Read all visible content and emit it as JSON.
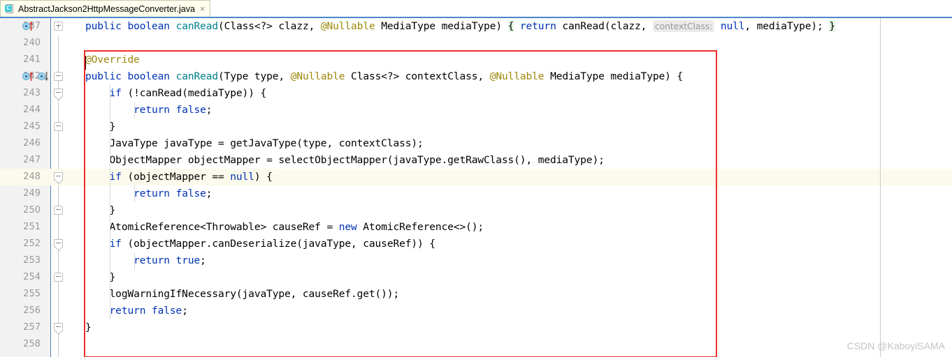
{
  "tab": {
    "icon": "java-class-icon",
    "icon_letter": "C",
    "label": "AbstractJackson2HttpMessageConverter.java",
    "close_glyph": "×"
  },
  "editor": {
    "language": "java",
    "current_line": 248,
    "right_margin_column_guide": true,
    "colors": {
      "keyword": "#0033b3",
      "method": "#00808c",
      "annotation": "#9e880d",
      "text": "#000000",
      "line_number": "#999999",
      "gutter_bg": "#f2f2f2",
      "current_line_bg": "#fcfaec",
      "brace_match_bg": "#e3f7e3",
      "param_hint_bg": "#ebebeb",
      "param_hint_fg": "#999999",
      "annotation_box": "#ee2f2a"
    },
    "lines": [
      {
        "number": "237",
        "gutter_icons": [
          "implementing-method-icon"
        ],
        "fold": "plus",
        "indent_guides": 0,
        "tokens": [
          {
            "t": "public",
            "c": "kw"
          },
          {
            "t": " ",
            "c": "pun"
          },
          {
            "t": "boolean",
            "c": "kw"
          },
          {
            "t": " ",
            "c": "pun"
          },
          {
            "t": "canRead",
            "c": "mth"
          },
          {
            "t": "(Class<?> clazz, ",
            "c": "pun"
          },
          {
            "t": "@Nullable",
            "c": "anno"
          },
          {
            "t": " MediaType mediaType) ",
            "c": "pun"
          },
          {
            "t": "{",
            "c": "brmatch"
          },
          {
            "t": " ",
            "c": "pun"
          },
          {
            "t": "return",
            "c": "kw"
          },
          {
            "t": " canRead(clazz, ",
            "c": "pun"
          },
          {
            "t": "contextClass:",
            "c": "hint"
          },
          {
            "t": " ",
            "c": "pun"
          },
          {
            "t": "null",
            "c": "kw"
          },
          {
            "t": ", mediaType); ",
            "c": "pun"
          },
          {
            "t": "}",
            "c": "brmatch"
          }
        ]
      },
      {
        "number": "240",
        "gutter_icons": [],
        "fold": "",
        "indent_guides": 0,
        "tokens": []
      },
      {
        "number": "241",
        "gutter_icons": [],
        "fold": "",
        "indent_guides": 0,
        "tokens": [
          {
            "t": "@Override",
            "c": "anno"
          }
        ]
      },
      {
        "number": "242",
        "gutter_icons": [
          "implementing-method-icon",
          "overridden-method-icon"
        ],
        "fold": "minus-top",
        "indent_guides": 0,
        "tokens": [
          {
            "t": "public",
            "c": "kw"
          },
          {
            "t": " ",
            "c": "pun"
          },
          {
            "t": "boolean",
            "c": "kw"
          },
          {
            "t": " ",
            "c": "pun"
          },
          {
            "t": "canRead",
            "c": "mth"
          },
          {
            "t": "(Type type, ",
            "c": "pun"
          },
          {
            "t": "@Nullable",
            "c": "anno"
          },
          {
            "t": " Class<?> contextClass, ",
            "c": "pun"
          },
          {
            "t": "@Nullable",
            "c": "anno"
          },
          {
            "t": " MediaType mediaType) {",
            "c": "pun"
          }
        ]
      },
      {
        "number": "243",
        "gutter_icons": [],
        "fold": "minus-bot",
        "indent_guides": 1,
        "tokens": [
          {
            "t": "    ",
            "c": "pun"
          },
          {
            "t": "if",
            "c": "kw"
          },
          {
            "t": " (!canRead(mediaType)) {",
            "c": "pun"
          }
        ]
      },
      {
        "number": "244",
        "gutter_icons": [],
        "fold": "",
        "indent_guides": 2,
        "tokens": [
          {
            "t": "        ",
            "c": "pun"
          },
          {
            "t": "return",
            "c": "kw"
          },
          {
            "t": " ",
            "c": "pun"
          },
          {
            "t": "false",
            "c": "kw"
          },
          {
            "t": ";",
            "c": "pun"
          }
        ]
      },
      {
        "number": "245",
        "gutter_icons": [],
        "fold": "minus-top",
        "indent_guides": 1,
        "tokens": [
          {
            "t": "    }",
            "c": "pun"
          }
        ]
      },
      {
        "number": "246",
        "gutter_icons": [],
        "fold": "",
        "indent_guides": 1,
        "tokens": [
          {
            "t": "    JavaType javaType = getJavaType(type, contextClass);",
            "c": "pun"
          }
        ]
      },
      {
        "number": "247",
        "gutter_icons": [],
        "fold": "",
        "indent_guides": 1,
        "tokens": [
          {
            "t": "    ObjectMapper objectMapper = selectObjectMapper(javaType.getRawClass(), mediaType);",
            "c": "pun"
          }
        ]
      },
      {
        "number": "248",
        "gutter_icons": [],
        "fold": "minus-bot",
        "indent_guides": 1,
        "current": true,
        "tokens": [
          {
            "t": "    ",
            "c": "pun"
          },
          {
            "t": "if",
            "c": "kw"
          },
          {
            "t": " (objectMapper == ",
            "c": "pun"
          },
          {
            "t": "null",
            "c": "kw"
          },
          {
            "t": ") {",
            "c": "pun"
          }
        ]
      },
      {
        "number": "249",
        "gutter_icons": [],
        "fold": "",
        "indent_guides": 2,
        "tokens": [
          {
            "t": "        ",
            "c": "pun"
          },
          {
            "t": "return",
            "c": "kw"
          },
          {
            "t": " ",
            "c": "pun"
          },
          {
            "t": "false",
            "c": "kw"
          },
          {
            "t": ";",
            "c": "pun"
          }
        ]
      },
      {
        "number": "250",
        "gutter_icons": [],
        "fold": "minus-top",
        "indent_guides": 1,
        "tokens": [
          {
            "t": "    }",
            "c": "pun"
          }
        ]
      },
      {
        "number": "251",
        "gutter_icons": [],
        "fold": "",
        "indent_guides": 1,
        "tokens": [
          {
            "t": "    AtomicReference<Throwable> causeRef = ",
            "c": "pun"
          },
          {
            "t": "new",
            "c": "kw"
          },
          {
            "t": " AtomicReference<>();",
            "c": "pun"
          }
        ]
      },
      {
        "number": "252",
        "gutter_icons": [],
        "fold": "minus-bot",
        "indent_guides": 1,
        "tokens": [
          {
            "t": "    ",
            "c": "pun"
          },
          {
            "t": "if",
            "c": "kw"
          },
          {
            "t": " (objectMapper.canDeserialize(javaType, causeRef)) {",
            "c": "pun"
          }
        ]
      },
      {
        "number": "253",
        "gutter_icons": [],
        "fold": "",
        "indent_guides": 2,
        "tokens": [
          {
            "t": "        ",
            "c": "pun"
          },
          {
            "t": "return",
            "c": "kw"
          },
          {
            "t": " ",
            "c": "pun"
          },
          {
            "t": "true",
            "c": "kw"
          },
          {
            "t": ";",
            "c": "pun"
          }
        ]
      },
      {
        "number": "254",
        "gutter_icons": [],
        "fold": "minus-top",
        "indent_guides": 1,
        "tokens": [
          {
            "t": "    }",
            "c": "pun"
          }
        ]
      },
      {
        "number": "255",
        "gutter_icons": [],
        "fold": "",
        "indent_guides": 1,
        "tokens": [
          {
            "t": "    logWarningIfNecessary(javaType, causeRef.get());",
            "c": "pun"
          }
        ]
      },
      {
        "number": "256",
        "gutter_icons": [],
        "fold": "",
        "indent_guides": 1,
        "tokens": [
          {
            "t": "    ",
            "c": "pun"
          },
          {
            "t": "return",
            "c": "kw"
          },
          {
            "t": " ",
            "c": "pun"
          },
          {
            "t": "false",
            "c": "kw"
          },
          {
            "t": ";",
            "c": "pun"
          }
        ]
      },
      {
        "number": "257",
        "gutter_icons": [],
        "fold": "minus-bot",
        "indent_guides": 0,
        "tokens": [
          {
            "t": "}",
            "c": "pun"
          }
        ]
      },
      {
        "number": "258",
        "gutter_icons": [],
        "fold": "",
        "indent_guides": 0,
        "tokens": []
      }
    ]
  },
  "watermark": {
    "text": "CSDN @KaboyiSAMA"
  }
}
